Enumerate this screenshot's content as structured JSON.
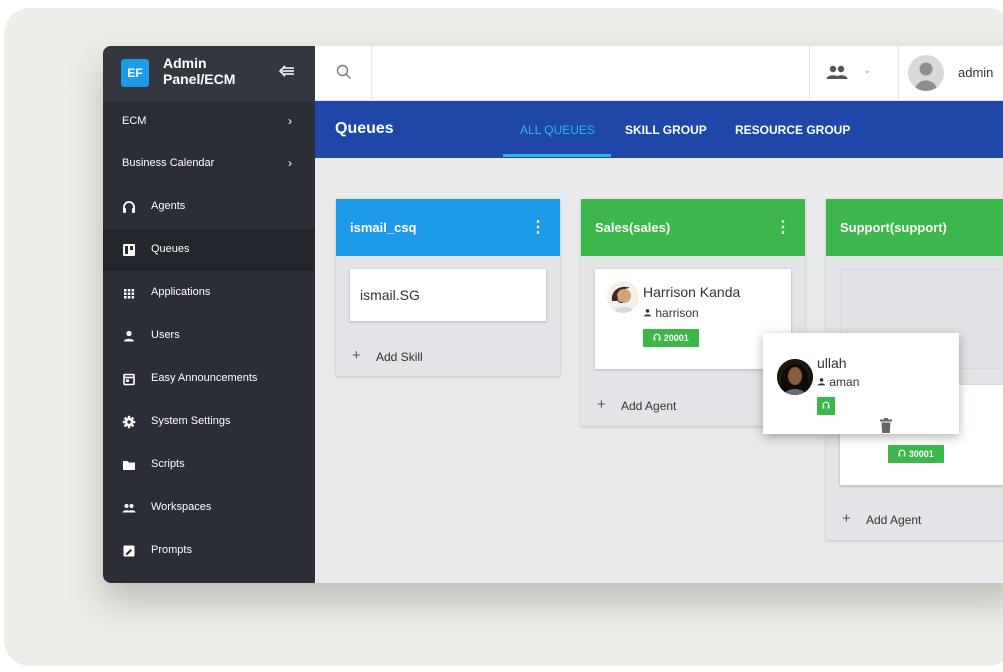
{
  "sidebar": {
    "logo": "EF",
    "title": "Admin Panel/ECM",
    "items": [
      {
        "label": "ECM",
        "icon": "none",
        "chevron": true,
        "active": false
      },
      {
        "label": "Business Calendar",
        "icon": "none",
        "chevron": true,
        "active": false
      },
      {
        "label": "Agents",
        "icon": "headset-icon",
        "chevron": false,
        "active": false
      },
      {
        "label": "Queues",
        "icon": "board-icon",
        "chevron": false,
        "active": true
      },
      {
        "label": "Applications",
        "icon": "grid-icon",
        "chevron": false,
        "active": false
      },
      {
        "label": "Users",
        "icon": "person-icon",
        "chevron": false,
        "active": false
      },
      {
        "label": "Easy Announcements",
        "icon": "calendar-icon",
        "chevron": false,
        "active": false
      },
      {
        "label": "System Settings",
        "icon": "gear-icon",
        "chevron": false,
        "active": false
      },
      {
        "label": "Scripts",
        "icon": "folder-icon",
        "chevron": false,
        "active": false
      },
      {
        "label": "Workspaces",
        "icon": "people-icon",
        "chevron": false,
        "active": false
      },
      {
        "label": "Prompts",
        "icon": "prompt-icon",
        "chevron": false,
        "active": false
      }
    ]
  },
  "topbar": {
    "user": "admin"
  },
  "header": {
    "title": "Queues",
    "tabs": [
      {
        "label": "ALL QUEUES",
        "active": true
      },
      {
        "label": "SKILL GROUP",
        "active": false
      },
      {
        "label": "RESOURCE GROUP",
        "active": false
      }
    ]
  },
  "queues": [
    {
      "title": "ismail_csq",
      "color": "#1e9be8",
      "card": "ismail.SG",
      "add_label": "Add Skill"
    },
    {
      "title": "Sales(sales)",
      "color": "#3db74b",
      "agent": {
        "name": "Harrison Kanda",
        "username": "harrison",
        "extension": "20001"
      },
      "add_label": "Add Agent"
    },
    {
      "title": "Support(support)",
      "color": "#3db74b",
      "extension": "30001",
      "add_label": "Add Agent"
    }
  ],
  "dragged_agent": {
    "name": "ullah",
    "username": "aman"
  },
  "colors": {
    "sidebar": "#2b2e36",
    "header": "#1f47aa",
    "accent": "#30b4f0",
    "green": "#3db74b",
    "blue": "#1e9be8"
  }
}
